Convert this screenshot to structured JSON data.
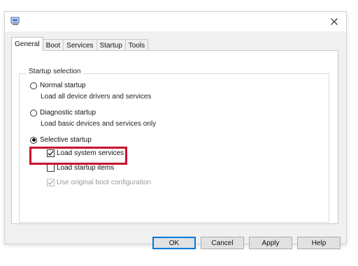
{
  "window": {
    "title": ""
  },
  "tabs": [
    {
      "label": "General",
      "active": true
    },
    {
      "label": "Boot"
    },
    {
      "label": "Services"
    },
    {
      "label": "Startup"
    },
    {
      "label": "Tools"
    }
  ],
  "general": {
    "group_title": "Startup selection",
    "normal": {
      "label": "Normal startup",
      "desc": "Load all device drivers and services",
      "selected": false
    },
    "diagnostic": {
      "label": "Diagnostic startup",
      "desc": "Load basic devices and services only",
      "selected": false
    },
    "selective": {
      "label": "Selective startup",
      "selected": true,
      "options": {
        "load_system_services": {
          "label": "Load system services",
          "checked": true
        },
        "load_startup_items": {
          "label": "Load startup items",
          "checked": false
        },
        "use_original_boot": {
          "label": "Use original boot configuration",
          "checked": true,
          "disabled": true
        }
      }
    }
  },
  "buttons": {
    "ok": "OK",
    "cancel": "Cancel",
    "apply": "Apply",
    "help": "Help"
  },
  "colors": {
    "highlight": "#c8102e",
    "default_button_border": "#0078d7"
  },
  "icons": {
    "app": "msconfig-icon",
    "close": "close-icon",
    "check": "check-icon"
  }
}
